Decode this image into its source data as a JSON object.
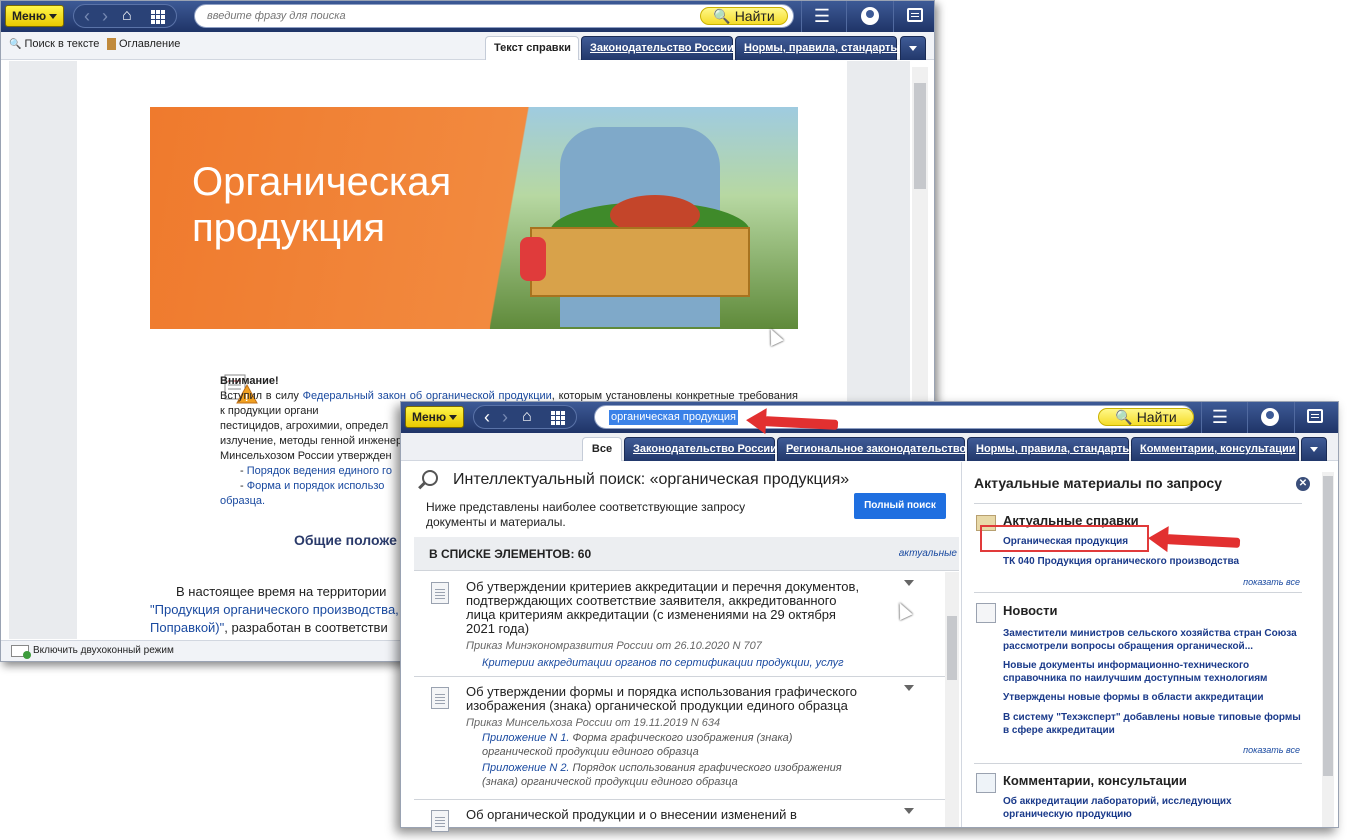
{
  "window1": {
    "menu_label": "Меню",
    "search_placeholder": "введите фразу для поиска",
    "find_label": "Найти",
    "tools": {
      "search_in_text": "Поиск в тексте",
      "contents": "Оглавление"
    },
    "tabs": [
      {
        "label": "Текст справки",
        "active": true
      },
      {
        "label": "Законодательство России",
        "active": false
      },
      {
        "label": "Нормы, правила, стандарты",
        "active": false
      }
    ],
    "banner_title_line1": "Органическая",
    "banner_title_line2": "продукция",
    "notice": {
      "heading": "Внимание!",
      "text1": "Вступил в силу ",
      "link1": "Федеральный закон об органической продукции",
      "text2": ", которым установлены конкретные требования к продукции органи",
      "text3": "пестицидов, агрохимии, определ",
      "text4": "излучение, методы генной инженер",
      "text5": "Минсельхозом России утвержден",
      "item1_prefix": "- ",
      "item1": "Порядок ведения единого го",
      "item2_prefix": "- ",
      "item2": "Форма и порядок использо",
      "item2_tail": "образца."
    },
    "section_title": "Общие положе",
    "para": {
      "line1": "В настоящее время на территории",
      "link": "\"Продукция органического производства,",
      "link2": "Поправкой)\"",
      "tail": ", разработан в соответстви"
    },
    "status_text": "Включить двухоконный режим"
  },
  "window2": {
    "menu_label": "Меню",
    "search_value": "органическая продукция",
    "find_label": "Найти",
    "tabs": [
      {
        "label": "Все",
        "active": true
      },
      {
        "label": "Законодательство России",
        "active": false
      },
      {
        "label": "Региональное законодательство",
        "active": false
      },
      {
        "label": "Нормы, правила, стандарты",
        "active": false
      },
      {
        "label": "Комментарии, консультации",
        "active": false
      }
    ],
    "search_header": "Интеллектуальный поиск: «органическая продукция»",
    "search_sub": "Ниже представлены наиболее соответствующие запросу документы и материалы.",
    "full_search_label": "Полный поиск",
    "list_count": "В СПИСКЕ ЭЛЕМЕНТОВ: 60",
    "list_actual": "актуальные",
    "items": [
      {
        "title": "Об утверждении критериев аккредитации и перечня документов, подтверждающих соответствие заявителя, аккредитованного лица критериям аккредитации (с изменениями на 29 октября 2021 года)",
        "meta": "Приказ Минэкономразвития России от 26.10.2020 N 707",
        "links": [
          {
            "a": "Критерии аккредитации органов по сертификации продукции, услуг",
            "b": ""
          }
        ]
      },
      {
        "title": "Об утверждении формы и порядка использования графического изображения (знака) органической продукции единого образца",
        "meta": "Приказ Минсельхоза России от 19.11.2019 N 634",
        "links": [
          {
            "a": "Приложение N 1.",
            "b": " Форма графического изображения (знака) органической продукции единого образца"
          },
          {
            "a": "Приложение N 2.",
            "b": " Порядок использования графического изображения (знака) органической продукции единого образца"
          }
        ]
      },
      {
        "title": "Об органической продукции и о внесении изменений в",
        "meta": "",
        "links": []
      }
    ],
    "right": {
      "title": "Актуальные материалы по запросу",
      "close_glyph": "✕",
      "sections": [
        {
          "heading": "Актуальные справки",
          "links": [
            "Органическая продукция",
            "ТК 040 Продукция органического производства"
          ],
          "more": "показать все"
        },
        {
          "heading": "Новости",
          "links": [
            "Заместители министров сельского хозяйства стран Союза рассмотрели вопросы обращения органической...",
            "Новые документы информационно-технического справочника по наилучшим доступным технологиям",
            "Утверждены новые формы в области аккредитации",
            "В систему \"Техэксперт\" добавлены новые типовые формы в сфере аккредитации"
          ],
          "more": "показать все"
        },
        {
          "heading": "Комментарии, консультации",
          "links": [
            "Об аккредитации лабораторий, исследующих органическую продукцию"
          ],
          "more": ""
        }
      ]
    }
  },
  "colors": {
    "toolbar": "#1f3467",
    "menu_yellow": "#f5dc2a",
    "banner_orange": "#f47b2a",
    "link_blue": "#1a4aa0",
    "highlight_red": "#e13a3a",
    "full_search_blue": "#1f6fe0"
  }
}
